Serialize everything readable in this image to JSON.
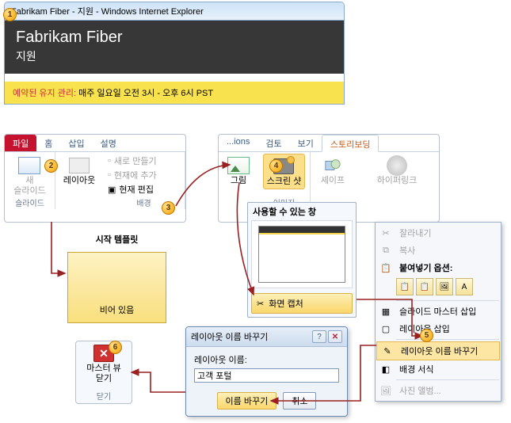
{
  "browser": {
    "title": "Fabrikam Fiber - 지원 - Windows Internet Explorer",
    "page_title": "Fabrikam Fiber",
    "page_subtitle": "지원",
    "maintenance_label": "예약된 유지 관리:",
    "maintenance_text": "매주 일요일 오전 3시 - 오후 6시 PST"
  },
  "ribbon1": {
    "tabs": {
      "file": "파일",
      "home": "홈",
      "insert": "삽입",
      "desc": "설명"
    },
    "group_slide": {
      "name": "슬라이드",
      "new_slide": "새\n슬라이드",
      "layout": "레이아웃"
    },
    "group_bg": {
      "name": "배경",
      "new": "새로 만들기",
      "add_current": "현재에 추가",
      "edit_current": "현재 편집"
    }
  },
  "ribbon2": {
    "tabs": {
      "ions": "...ions",
      "review": "검토",
      "view": "보기",
      "story": "스토리보딩"
    },
    "group_img": {
      "name": "이미지",
      "picture": "그림",
      "screenshot": "스크린 샷",
      "shapes": "셰이프",
      "hyperlink": "하이퍼링크"
    }
  },
  "template": {
    "header": "시작 템플릿",
    "empty": "비어 있음"
  },
  "popup": {
    "header": "사용할 수 있는 창",
    "capture": "화면 캡처"
  },
  "context_menu": {
    "cut": "잘라내기",
    "copy": "복사",
    "paste_header": "붙여넣기 옵션:",
    "insert_master": "슬라이드 마스터 삽입",
    "insert_layout": "레이아웃 삽입",
    "rename_layout": "레이아웃 이름 바꾸기",
    "bg_format": "배경 서식",
    "photo_album": "사진 앨범..."
  },
  "dialog": {
    "title": "레이아웃 이름 바꾸기",
    "label": "레이아웃 이름:",
    "value": "고객 포털",
    "ok": "이름 바꾸기",
    "cancel": "취소"
  },
  "close_panel": {
    "label": "마스터 뷰\n닫기",
    "group": "닫기"
  },
  "callouts": [
    "1",
    "2",
    "3",
    "4",
    "5",
    "6"
  ]
}
